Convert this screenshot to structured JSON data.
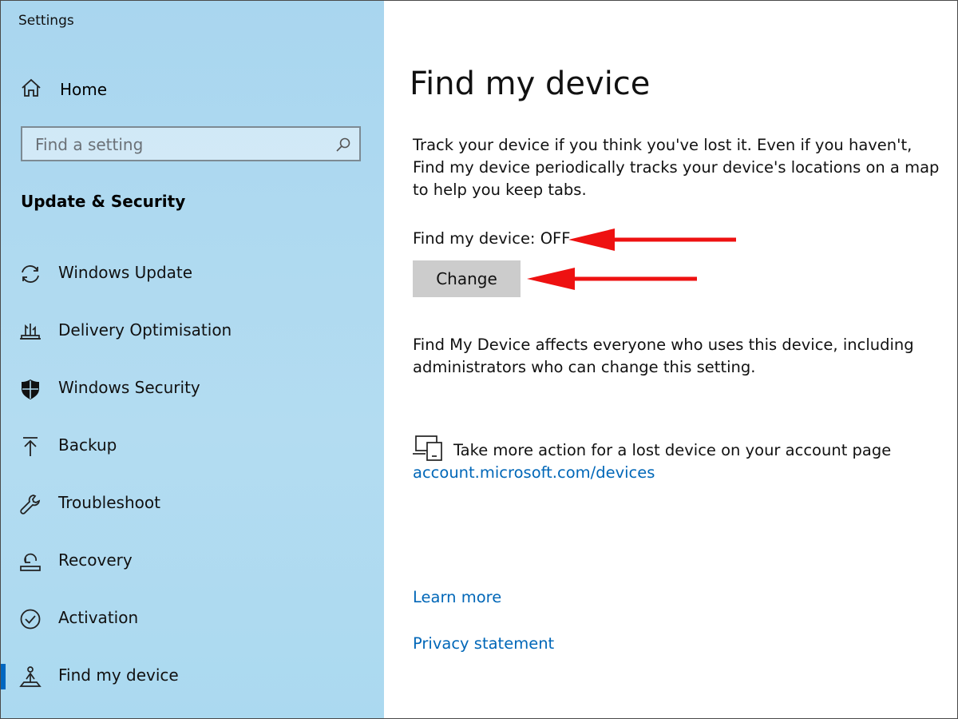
{
  "window": {
    "title": "Settings"
  },
  "sidebar": {
    "home_label": "Home",
    "search_placeholder": "Find a setting",
    "section_title": "Update & Security",
    "items": [
      {
        "label": "Windows Update",
        "icon": "sync-icon"
      },
      {
        "label": "Delivery Optimisation",
        "icon": "delivery-optimisation-icon"
      },
      {
        "label": "Windows Security",
        "icon": "shield-icon"
      },
      {
        "label": "Backup",
        "icon": "upload-arrow-icon"
      },
      {
        "label": "Troubleshoot",
        "icon": "wrench-icon"
      },
      {
        "label": "Recovery",
        "icon": "recovery-icon"
      },
      {
        "label": "Activation",
        "icon": "check-circle-icon"
      },
      {
        "label": "Find my device",
        "icon": "person-locate-icon",
        "active": true
      }
    ]
  },
  "main": {
    "title": "Find my device",
    "description": "Track your device if you think you've lost it. Even if you haven't, Find my device periodically tracks your device's locations on a map to help you keep tabs.",
    "status_text": "Find my device: OFF",
    "change_button": "Change",
    "note": "Find My Device affects everyone who uses this device, including administrators who can change this setting.",
    "action_text": "Take more action for a lost device on your account page",
    "account_link": "account.microsoft.com/devices",
    "learn_more": "Learn more",
    "privacy_statement": "Privacy statement"
  },
  "colors": {
    "sidebar_bg": "#abd9f0",
    "accent": "#0067c0",
    "link": "#0067b8",
    "button_bg": "#cccccc",
    "annotation_arrow": "#ee1111"
  }
}
